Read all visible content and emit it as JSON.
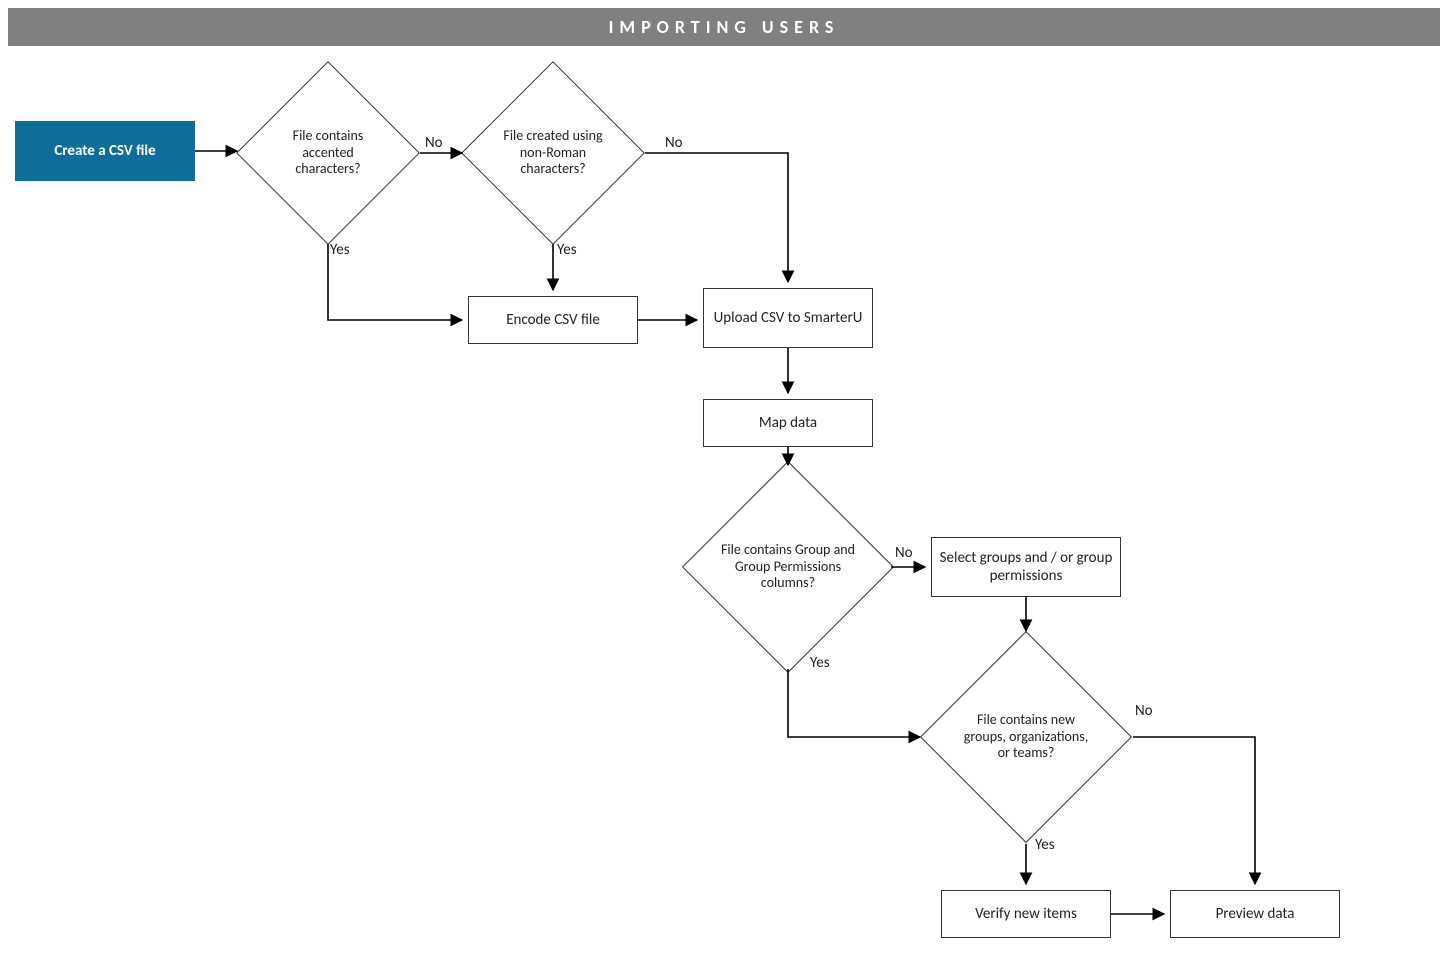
{
  "header": {
    "title": "IMPORTING USERS"
  },
  "nodes": {
    "start": "Create a CSV file",
    "d1": "File contains accented characters?",
    "d2": "File created using non-Roman characters?",
    "encode": "Encode CSV file",
    "upload": "Upload CSV to SmarterU",
    "map": "Map data",
    "d3": "File contains Group and Group Permissions columns?",
    "select": "Select groups and / or group permissions",
    "d4": "File contains new groups, organizations, or teams?",
    "verify": "Verify new items",
    "preview": "Preview data"
  },
  "labels": {
    "yes": "Yes",
    "no": "No"
  }
}
